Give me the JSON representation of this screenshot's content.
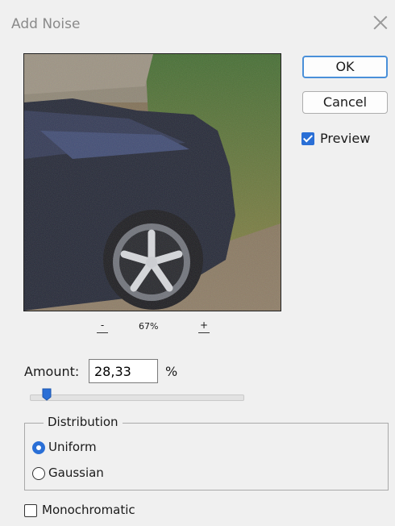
{
  "window": {
    "title": "Add Noise"
  },
  "preview": {
    "zoom_level": "67%",
    "zoom_out": "-",
    "zoom_in": "+"
  },
  "buttons": {
    "ok": "OK",
    "cancel": "Cancel"
  },
  "preview_checkbox": {
    "label": "Preview",
    "checked": true
  },
  "amount": {
    "label": "Amount:",
    "value": "28,33",
    "unit": "%",
    "slider_fraction": 0.08
  },
  "distribution": {
    "legend": "Distribution",
    "options": [
      {
        "label": "Uniform",
        "selected": true
      },
      {
        "label": "Gaussian",
        "selected": false
      }
    ]
  },
  "monochromatic": {
    "label": "Monochromatic",
    "checked": false
  },
  "colors": {
    "accent": "#2a6fd6",
    "ok_border": "#4a90d9"
  }
}
